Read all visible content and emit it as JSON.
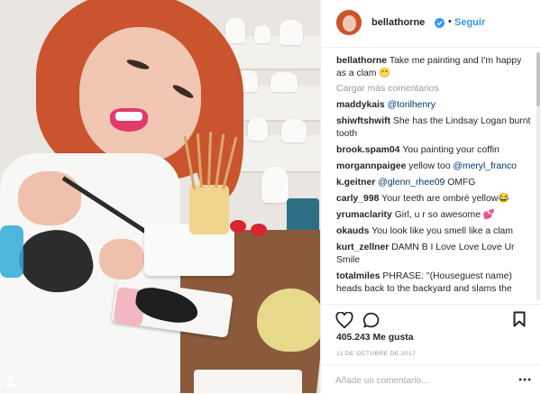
{
  "post": {
    "image_alt": "Woman with red hair smiling while painting ceramics",
    "tagged_icon": "user-tag-icon"
  },
  "header": {
    "username": "bellathorne",
    "verified_icon": "verified-badge-icon",
    "separator": "•",
    "follow_label": "Seguir"
  },
  "caption": {
    "username": "bellathorne",
    "text": "Take me painting and I'm happy as a clam 😬"
  },
  "load_more": "Cargar más comentarios",
  "comments": [
    {
      "user": "maddykais",
      "text": "@torilhenry",
      "mention": true
    },
    {
      "user": "shiwftshwift",
      "text": "She has the Lindsay Logan burnt tooth",
      "mention": false
    },
    {
      "user": "brook.spam04",
      "text": "You painting your coffin",
      "mention": false
    },
    {
      "user": "morgannpaigee",
      "text": "yellow too ",
      "mention_text": "@meryl_franco",
      "mention": false
    },
    {
      "user": "k.geitner",
      "text": "@glenn_rhee09",
      "extra": " OMFG",
      "mention": true
    },
    {
      "user": "carly_998",
      "text": "Your teeth are ombré yellow😂",
      "mention": false
    },
    {
      "user": "yrumaclarity",
      "text": "Girl, u r so awesome 💕",
      "mention": false
    },
    {
      "user": "okauds",
      "text": "You look like you smell like a clam",
      "mention": false
    },
    {
      "user": "kurt_zellner",
      "text": "DAMN B I Love Love Love Ur Smile",
      "mention": false
    },
    {
      "user": "totalmiles",
      "text": "PHRASE: \"(Houseguest name) heads back to the backyard and slams the",
      "mention": false
    }
  ],
  "actions": {
    "like_icon": "heart-icon",
    "comment_icon": "comment-bubble-icon",
    "save_icon": "bookmark-icon"
  },
  "likes": "405.243 Me gusta",
  "date": "11 DE OCTUBRE DE 2017",
  "add_comment": {
    "placeholder": "Añade un comentario...",
    "more_icon": "more-options-icon"
  },
  "colors": {
    "link": "#3897f0",
    "text": "#262626",
    "muted": "#999999",
    "mention": "#003569"
  }
}
